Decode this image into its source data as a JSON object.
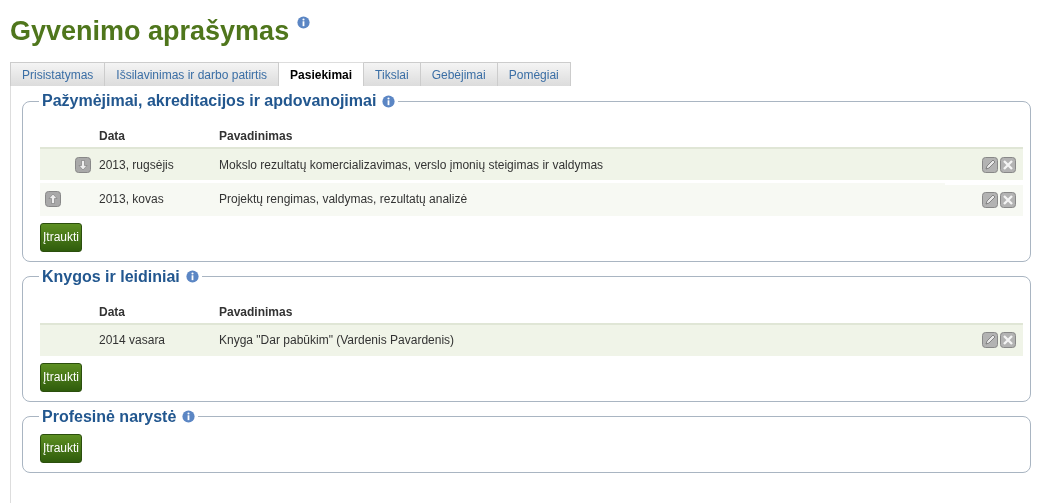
{
  "title": "Gyvenimo aprašymas",
  "tabs": [
    {
      "label": "Prisistatymas",
      "selected": false
    },
    {
      "label": "Išsilavinimas ir darbo patirtis",
      "selected": false
    },
    {
      "label": "Pasiekimai",
      "selected": true
    },
    {
      "label": "Tikslai",
      "selected": false
    },
    {
      "label": "Gebėjimai",
      "selected": false
    },
    {
      "label": "Pomėgiai",
      "selected": false
    }
  ],
  "sections": [
    {
      "title": "Pažymėjimai, akreditacijos ir apdovanojimai",
      "columns": [
        "Data",
        "Pavadinimas"
      ],
      "rows": [
        {
          "kind": "down",
          "date": "2013, rugsėjis",
          "name": "Mokslo rezultatų komercializavimas, verslo įmonių steigimas ir valdymas"
        },
        {
          "kind": "up",
          "date": "2013, kovas",
          "name": "Projektų rengimas, valdymas, rezultatų analizė"
        }
      ],
      "button": "Įtraukti"
    },
    {
      "title": "Knygos ir leidiniai",
      "columns": [
        "Data",
        "Pavadinimas"
      ],
      "rows": [
        {
          "kind": "plain",
          "date": "2014 vasara",
          "name": "Knyga \"Dar pabūkim\" (Vardenis Pavardenis)"
        }
      ],
      "button": "Įtraukti"
    },
    {
      "title": "Profesinė narystė",
      "button": "Įtraukti"
    }
  ]
}
